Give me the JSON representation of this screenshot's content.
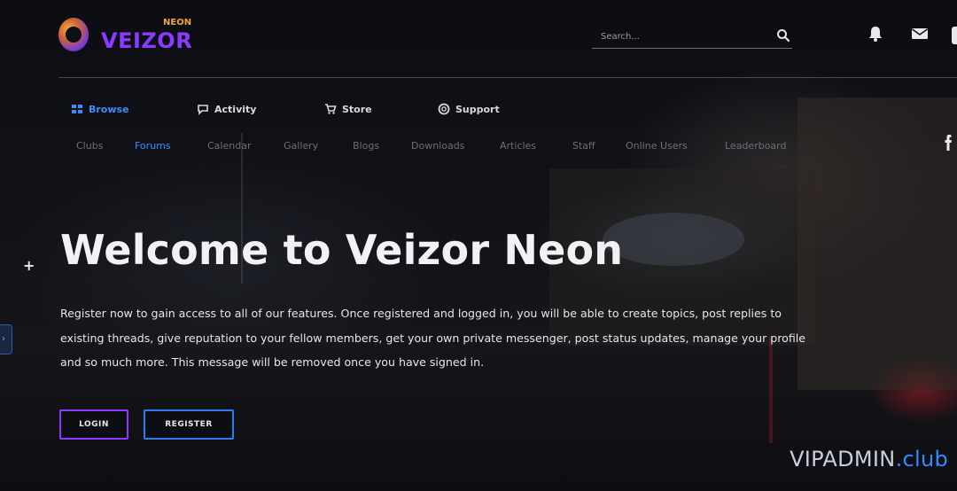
{
  "brand": {
    "name": "VEIZOR",
    "tag": "NEON",
    "primary_color": "#8b3bff",
    "accent_color": "#f0a63a"
  },
  "header": {
    "search_placeholder": "Search...",
    "icons": [
      "search-icon",
      "bell-icon",
      "envelope-icon"
    ]
  },
  "main_nav": [
    {
      "label": "Browse",
      "icon": "grid-icon",
      "active": true
    },
    {
      "label": "Activity",
      "icon": "chat-bubble-icon",
      "active": false
    },
    {
      "label": "Store",
      "icon": "cart-icon",
      "active": false
    },
    {
      "label": "Support",
      "icon": "lifebuoy-icon",
      "active": false
    }
  ],
  "sub_nav": [
    {
      "label": "Clubs",
      "active": false
    },
    {
      "label": "Forums",
      "active": true
    },
    {
      "label": "Calendar",
      "active": false
    },
    {
      "label": "Gallery",
      "active": false
    },
    {
      "label": "Blogs",
      "active": false
    },
    {
      "label": "Downloads",
      "active": false
    },
    {
      "label": "Articles",
      "active": false
    },
    {
      "label": "Staff",
      "active": false
    },
    {
      "label": "Online Users",
      "active": false
    },
    {
      "label": "Leaderboard",
      "active": false
    }
  ],
  "hero": {
    "title": "Welcome to Veizor Neon",
    "text": "Register now to gain access to all of our features. Once registered and logged in, you will be able to create topics, post replies to existing threads, give reputation to your fellow members, get your own private messenger, post status updates, manage your profile and so much more. This message will be removed once you have signed in.",
    "login_label": "LOGIN",
    "register_label": "REGISTER"
  },
  "watermark": {
    "main": "VIPADMIN",
    "suffix": ".club",
    "suffix_color": "#2f8cff"
  }
}
